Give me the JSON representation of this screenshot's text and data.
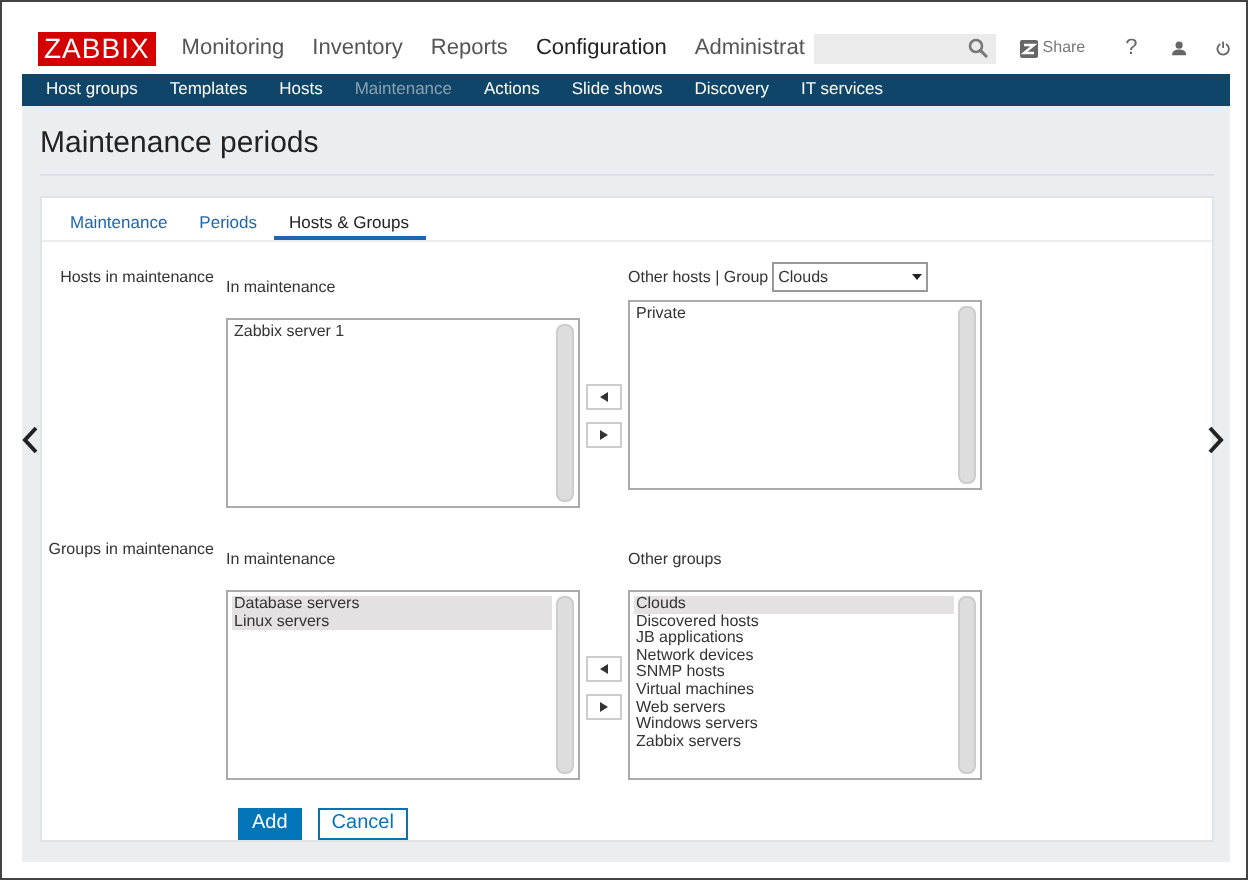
{
  "header": {
    "logo": "ZABBIX",
    "menu": [
      {
        "label": "Monitoring",
        "selected": false
      },
      {
        "label": "Inventory",
        "selected": false
      },
      {
        "label": "Reports",
        "selected": false
      },
      {
        "label": "Configuration",
        "selected": true
      },
      {
        "label": "Administrat",
        "selected": false
      }
    ],
    "share": "Share",
    "help": "?"
  },
  "subnav": [
    {
      "label": "Host groups",
      "selected": false
    },
    {
      "label": "Templates",
      "selected": false
    },
    {
      "label": "Hosts",
      "selected": false
    },
    {
      "label": "Maintenance",
      "selected": true
    },
    {
      "label": "Actions",
      "selected": false
    },
    {
      "label": "Slide shows",
      "selected": false
    },
    {
      "label": "Discovery",
      "selected": false
    },
    {
      "label": "IT services",
      "selected": false
    }
  ],
  "title": "Maintenance periods",
  "tabs": [
    {
      "label": "Maintenance",
      "selected": false
    },
    {
      "label": "Periods",
      "selected": false
    },
    {
      "label": "Hosts & Groups",
      "selected": true
    }
  ],
  "sections": [
    {
      "label": "Hosts in maintenance",
      "left_title": "In maintenance",
      "left_items": [
        {
          "label": "Zabbix server 1",
          "selected": false
        }
      ],
      "right_title": "Other hosts | Group",
      "group_select": "Clouds",
      "right_items": [
        {
          "label": "Private",
          "selected": false
        }
      ]
    },
    {
      "label": "Groups in maintenance",
      "left_title": "In maintenance",
      "left_items": [
        {
          "label": "Database servers",
          "selected": true
        },
        {
          "label": "Linux servers",
          "selected": true
        }
      ],
      "right_title": "Other groups",
      "right_items": [
        {
          "label": "Clouds",
          "selected": true
        },
        {
          "label": "Discovered hosts",
          "selected": false
        },
        {
          "label": "JB applications",
          "selected": false
        },
        {
          "label": "Network devices",
          "selected": false
        },
        {
          "label": "SNMP hosts",
          "selected": false
        },
        {
          "label": "Virtual machines",
          "selected": false
        },
        {
          "label": "Web servers",
          "selected": false
        },
        {
          "label": "Windows servers",
          "selected": false
        },
        {
          "label": "Zabbix servers",
          "selected": false
        }
      ]
    }
  ],
  "buttons": [
    {
      "label": "Add",
      "kind": "primary"
    },
    {
      "label": "Cancel",
      "kind": "secondary"
    }
  ]
}
